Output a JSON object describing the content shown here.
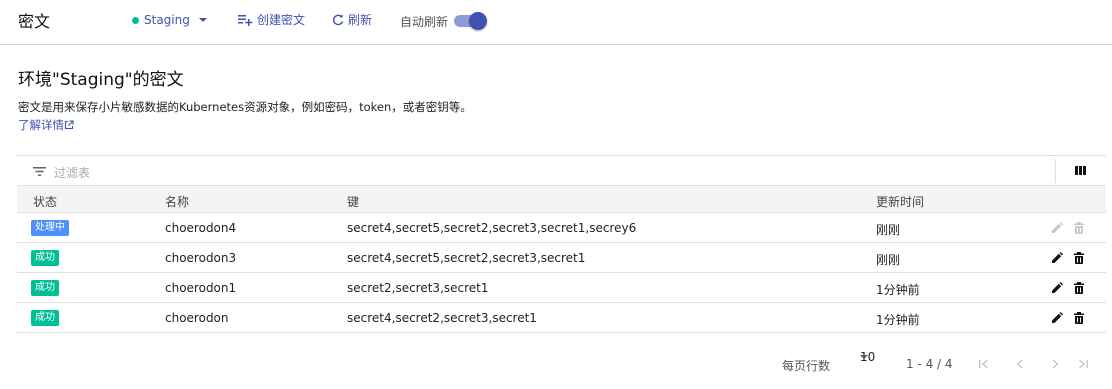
{
  "header": {
    "title": "密文",
    "environment": "Staging",
    "create_label": "创建密文",
    "refresh_label": "刷新",
    "auto_refresh_label": "自动刷新",
    "auto_refresh_on": true
  },
  "page": {
    "heading": "环境\"Staging\"的密文",
    "description": "密文是用来保存小片敏感数据的Kubernetes资源对象，例如密码，token，或者密钥等。",
    "learn_more": "了解详情"
  },
  "table": {
    "filter_placeholder": "过滤表",
    "columns": [
      "状态",
      "名称",
      "键",
      "更新时间"
    ],
    "rows": [
      {
        "status": "处理中",
        "status_type": "processing",
        "name": "choerodon4",
        "keys": "secret4,secret5,secret2,secret3,secret1,secrey6",
        "updated": "刚刚",
        "actions_enabled": false
      },
      {
        "status": "成功",
        "status_type": "success",
        "name": "choerodon3",
        "keys": "secret4,secret5,secret2,secret3,secret1",
        "updated": "刚刚",
        "actions_enabled": true
      },
      {
        "status": "成功",
        "status_type": "success",
        "name": "choerodon1",
        "keys": "secret2,secret3,secret1",
        "updated": "1分钟前",
        "actions_enabled": true
      },
      {
        "status": "成功",
        "status_type": "success",
        "name": "choerodon",
        "keys": "secret4,secret2,secret3,secret1",
        "updated": "1分钟前",
        "actions_enabled": true
      }
    ]
  },
  "pagination": {
    "rows_per_page_label": "每页行数",
    "rows_per_page": "10",
    "range": "1 - 4 / 4"
  },
  "colors": {
    "primary": "#3f51b5",
    "success": "#00bf96",
    "processing": "#4d90fe"
  }
}
